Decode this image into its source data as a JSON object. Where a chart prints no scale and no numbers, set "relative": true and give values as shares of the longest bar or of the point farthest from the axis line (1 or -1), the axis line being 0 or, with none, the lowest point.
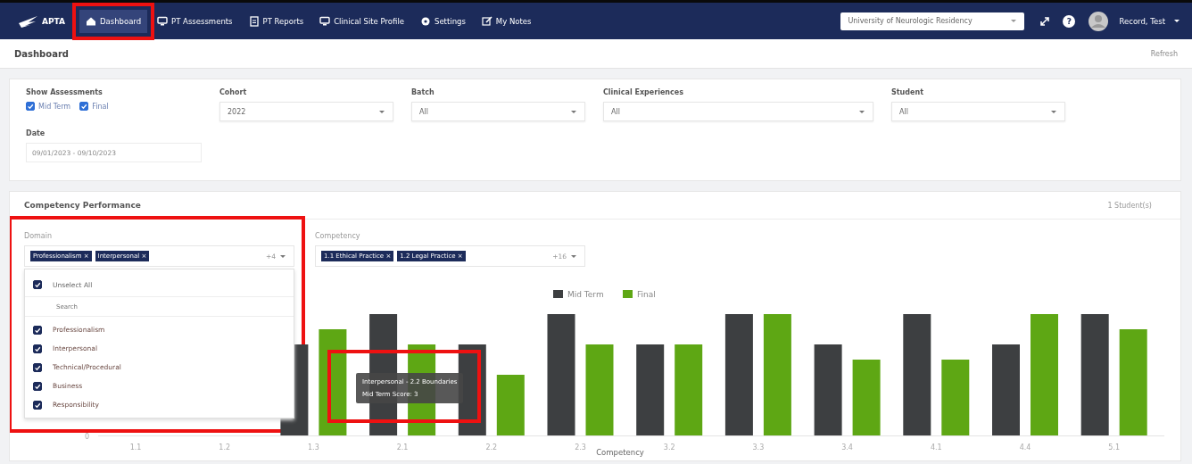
{
  "nav": {
    "logo": "APTA",
    "items": [
      {
        "label": "Dashboard",
        "selected": true,
        "highlighted": true
      },
      {
        "label": "PT Assessments",
        "selected": false,
        "highlighted": false
      },
      {
        "label": "PT Reports",
        "selected": false,
        "highlighted": false
      },
      {
        "label": "Clinical Site Profile",
        "selected": false,
        "highlighted": false
      },
      {
        "label": "Settings",
        "selected": false,
        "highlighted": false
      },
      {
        "label": "My Notes",
        "selected": false,
        "highlighted": false
      }
    ],
    "help_label": "?",
    "site_select": {
      "value": "University of Neurologic Residency"
    },
    "user": {
      "name": "Record, Test"
    }
  },
  "page_header": {
    "title": "Dashboard",
    "action": "Refresh"
  },
  "filters": {
    "show_assessments": {
      "label": "Show Assessments",
      "options": [
        {
          "label": "Mid Term",
          "checked": true
        },
        {
          "label": "Final",
          "checked": true
        }
      ]
    },
    "selects": [
      {
        "label": "Cohort",
        "value": "2022"
      },
      {
        "label": "Batch",
        "value": "All"
      },
      {
        "label": "Clinical Experiences",
        "value": "All"
      },
      {
        "label": "Student",
        "value": "All"
      }
    ],
    "date": {
      "label": "Date",
      "value": "09/01/2023 - 09/10/2023"
    }
  },
  "competency_performance": {
    "title": "Competency Performance",
    "count": "1 Student(s)",
    "domain": {
      "label": "Domain",
      "chips": [
        "Professionalism ×",
        "Interpersonal ×"
      ],
      "more": "+4",
      "highlighted": true,
      "dropdown": {
        "unselect_all": {
          "label": "Unselect All",
          "checked": true
        },
        "search_placeholder": "Search",
        "options": [
          {
            "label": "Professionalism",
            "checked": true
          },
          {
            "label": "Interpersonal",
            "checked": true
          },
          {
            "label": "Technical/Procedural",
            "checked": true
          },
          {
            "label": "Business",
            "checked": true
          },
          {
            "label": "Responsibility",
            "checked": true
          }
        ]
      }
    },
    "competency": {
      "label": "Competency",
      "chips": [
        "1.1 Ethical Practice ×",
        "1.2 Legal Practice ×"
      ],
      "more": "+16"
    },
    "chart_data": {
      "type": "bar",
      "xlabel": "Competency",
      "categories": [
        "1.1",
        "1.2",
        "1.3",
        "2.1",
        "2.2",
        "2.3",
        "3.2",
        "3.3",
        "3.4",
        "4.1",
        "4.4",
        "5.1"
      ],
      "series": [
        {
          "name": "Mid Term",
          "color": "#3d3f41",
          "values": [
            null,
            null,
            0.75,
            1,
            0.75,
            1,
            0.75,
            1,
            0.75,
            1,
            0.75,
            1
          ]
        },
        {
          "name": "Final",
          "color": "#5ea714",
          "values": [
            null,
            null,
            0.875,
            0.75,
            0.5,
            0.75,
            0.75,
            1,
            0.625,
            0.625,
            1,
            0.875
          ]
        }
      ],
      "legend": "top",
      "relative": true,
      "annotations": [
        {
          "text": "0"
        }
      ]
    },
    "tooltip": {
      "lines": [
        "Interpersonal - 2.2 Boundaries",
        "Mid Term Score: 3"
      ],
      "highlighted": true
    }
  }
}
